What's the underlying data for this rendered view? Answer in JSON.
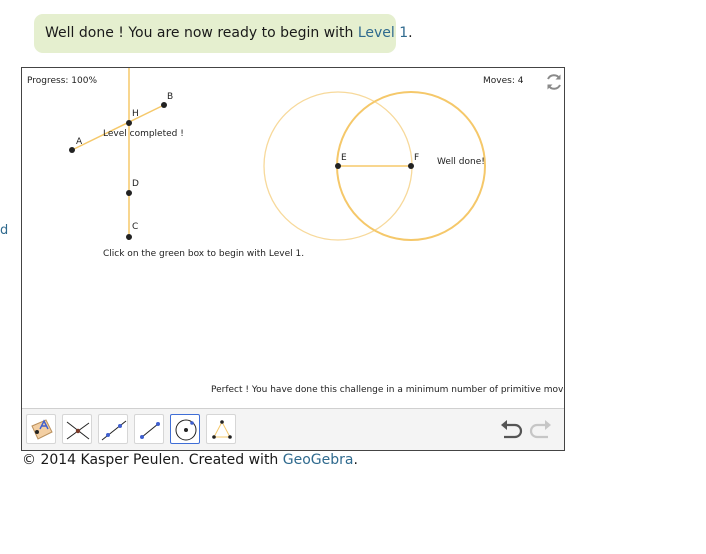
{
  "banner": {
    "prefix": "Well done ! You are now ready to begin with ",
    "link": "Level 1",
    "suffix": "."
  },
  "left_edge_fragment": "d",
  "applet": {
    "progress": "Progress: 100%",
    "moves": "Moves: 4",
    "points": {
      "A": "A",
      "B": "B",
      "H": "H",
      "D": "D",
      "C": "C",
      "E": "E",
      "F": "F"
    },
    "level_completed": "Level completed !",
    "well_done": "Well done!",
    "hint": "Click on the green box to begin with Level 1.",
    "perfect": "Perfect ! You have done this challenge in a minimum number of primitive moves!",
    "tools": [
      {
        "name": "move-tool"
      },
      {
        "name": "intersect-tool"
      },
      {
        "name": "line-tool"
      },
      {
        "name": "segment-tool"
      },
      {
        "name": "circle-tool",
        "selected": true
      },
      {
        "name": "triangle-tool"
      }
    ],
    "icons": [
      "reset-icon",
      "undo-icon",
      "redo-icon"
    ],
    "colors": {
      "construction": "#f5c86a",
      "construction_light": "#f7d99b",
      "selected_tool": "#3f6ed6"
    }
  },
  "footer": {
    "prefix": "© 2014 Kasper Peulen. Created with ",
    "link": "GeoGebra",
    "suffix": "."
  }
}
